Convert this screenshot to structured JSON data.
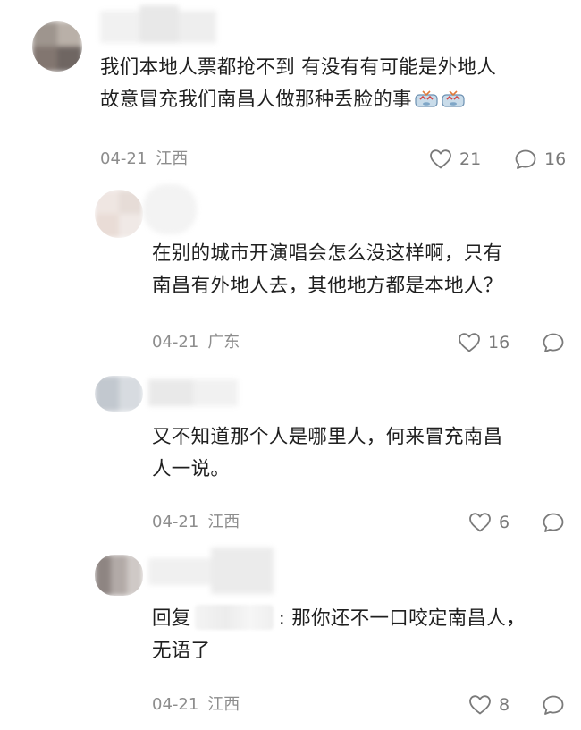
{
  "comments": [
    {
      "text_line1": "我们本地人票都抢不到 有没有有可能是外地人",
      "text_line2": "故意冒充我们南昌人做那种丢脸的事",
      "date": "04-21",
      "location": "江西",
      "likes": "21",
      "replies": "16"
    },
    {
      "text_line1": "在别的城市开演唱会怎么没这样啊，只有",
      "text_line2": "南昌有外地人去，其他地方都是本地人？",
      "date": "04-21",
      "location": "广东",
      "likes": "16"
    },
    {
      "text_line1": "又不知道那个人是哪里人，何来冒充南昌",
      "text_line2": "人一说。",
      "date": "04-21",
      "location": "江西",
      "likes": "6"
    },
    {
      "reply_prefix": "回复",
      "text_line1": ": 那你还不一口咬定南昌人，",
      "text_line2": "无语了",
      "date": "04-21",
      "location": "江西",
      "likes": "8"
    }
  ],
  "icons": {
    "like": "heart-icon",
    "comment": "comment-bubble-icon",
    "emoji": "crying-face-emoji-icon"
  },
  "colors": {
    "text": "#1f1f1f",
    "meta": "#8d8d8d",
    "icon": "#7a7a7a"
  }
}
